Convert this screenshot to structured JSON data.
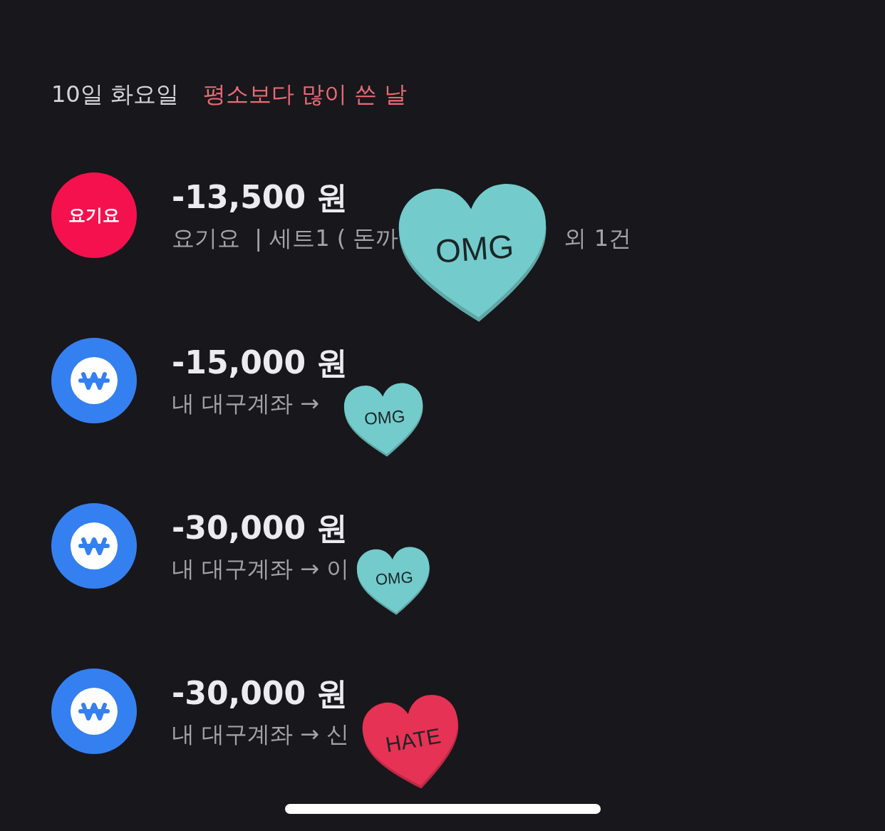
{
  "header": {
    "date": "10일 화요일",
    "note": "평소보다 많이 쓴 날"
  },
  "transactions": [
    {
      "kind": "yogiyo",
      "logo": "요기요",
      "amount": "-13,500 원",
      "detail": "요기요  | 세트1 ( 돈까",
      "detail_tail": "외 1건",
      "sticker": {
        "text": "OMG",
        "color": "#74cbcb"
      }
    },
    {
      "kind": "transfer",
      "amount": "-15,000 원",
      "detail": "내 대구계좌 →",
      "sticker": {
        "text": "OMG",
        "color": "#74cbcb"
      }
    },
    {
      "kind": "transfer",
      "amount": "-30,000 원",
      "detail": "내 대구계좌 → 이",
      "sticker": {
        "text": "OMG",
        "color": "#74cbcb"
      }
    },
    {
      "kind": "transfer",
      "amount": "-30,000 원",
      "detail": "내 대구계좌 → 신",
      "sticker": {
        "text": "HATE",
        "color": "#e63254"
      }
    }
  ]
}
